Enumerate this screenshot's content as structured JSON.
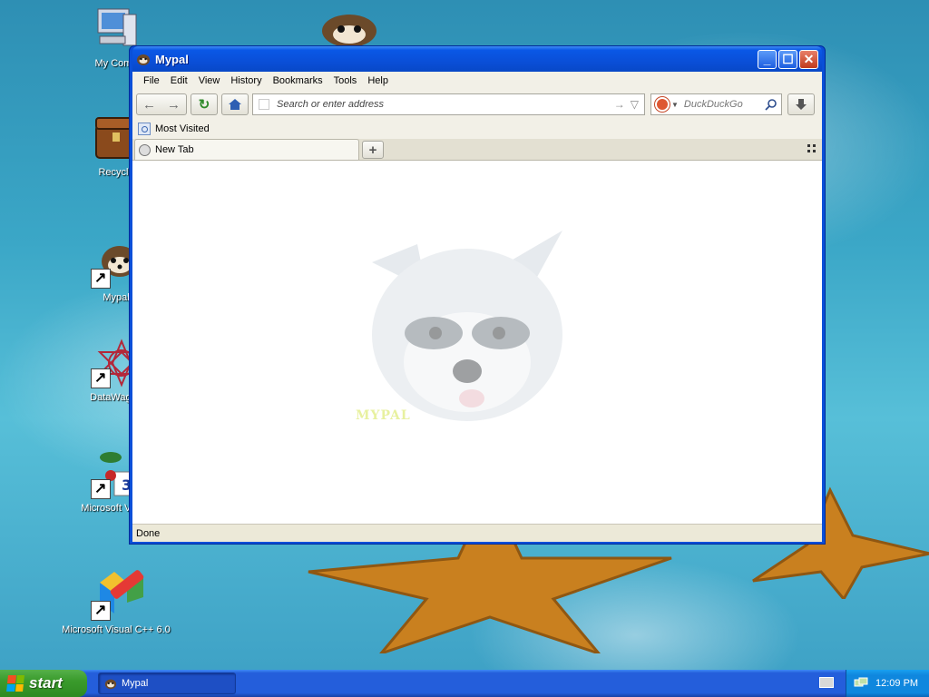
{
  "desktop": {
    "icons": [
      {
        "label": "My Comp",
        "icon": "my-computer-icon"
      },
      {
        "label": "Recycle",
        "icon": "recycle-bin-icon"
      },
      {
        "label": "Mypal",
        "icon": "mypal-raccoon-icon"
      },
      {
        "label": "DataWagon",
        "icon": "datawagon-icon"
      },
      {
        "label": "Microsoft Visual",
        "icon": "visual-tools-icon"
      },
      {
        "label": "Microsoft Visual C++ 6.0",
        "icon": "visual-cpp-icon"
      }
    ]
  },
  "window": {
    "title": "Mypal",
    "menu": [
      "File",
      "Edit",
      "View",
      "History",
      "Bookmarks",
      "Tools",
      "Help"
    ],
    "url_placeholder": "Search or enter address",
    "search_placeholder": "DuckDuckGo",
    "bookmarks": [
      "Most Visited"
    ],
    "tabs": [
      {
        "label": "New Tab"
      }
    ],
    "content_logo_text": "MYPAL",
    "status": "Done"
  },
  "taskbar": {
    "start_label": "start",
    "items": [
      {
        "label": "Mypal"
      }
    ],
    "clock": "12:09 PM"
  },
  "colors": {
    "title_bar": "#0a4fd8",
    "taskbar": "#245edb",
    "start_button": "#3a9b2c",
    "tray": "#0f87de"
  }
}
